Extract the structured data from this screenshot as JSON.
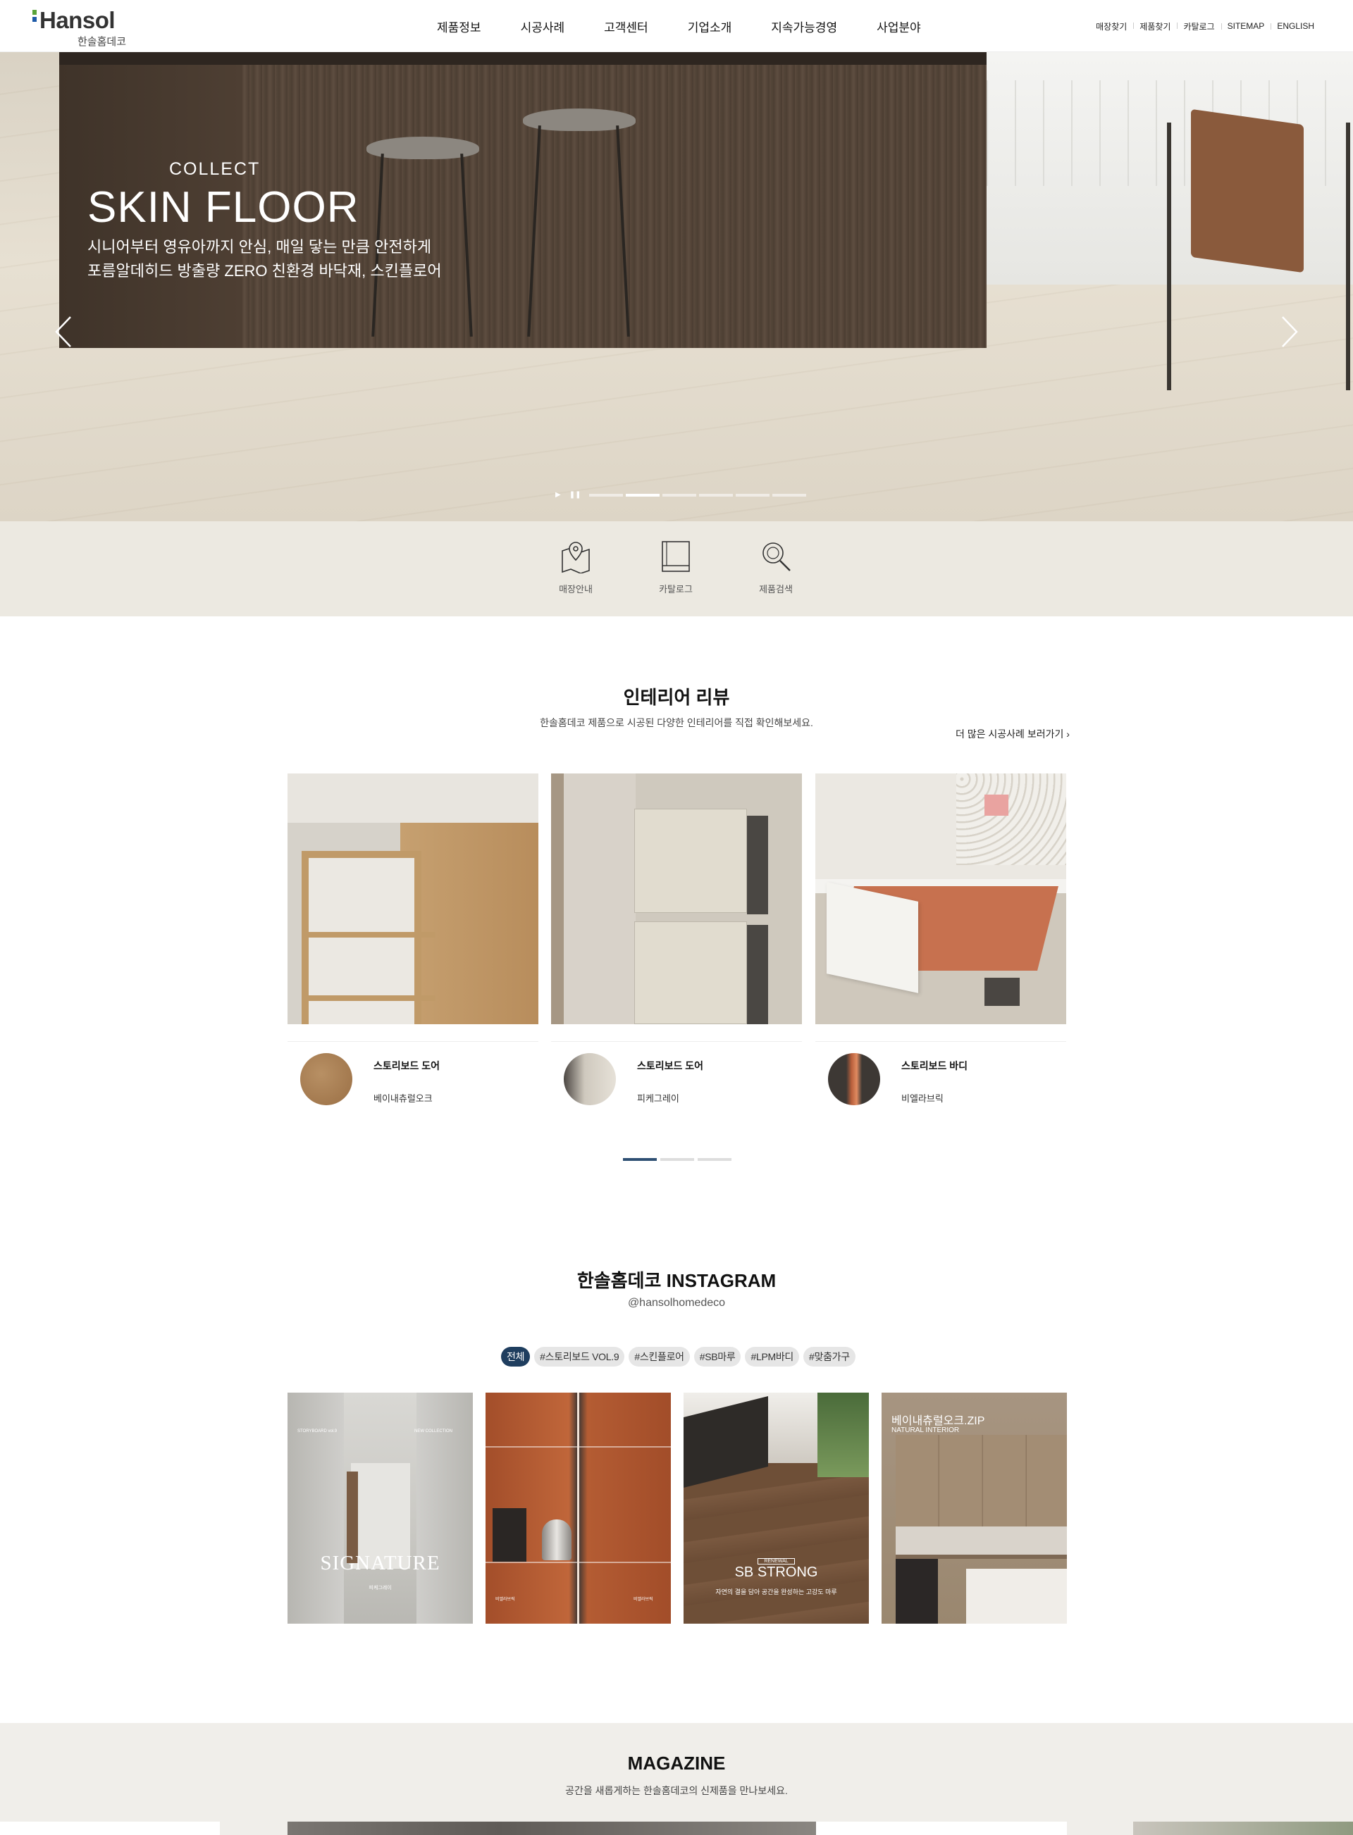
{
  "header": {
    "logo_word": "Hansol",
    "logo_sub": "한솔홈데코",
    "nav": [
      "제품정보",
      "시공사례",
      "고객센터",
      "기업소개",
      "지속가능경영",
      "사업분야"
    ],
    "util": [
      "매장찾기",
      "제품찾기",
      "카탈로그",
      "SITEMAP",
      "ENGLISH"
    ]
  },
  "hero": {
    "kicker": "COLLECT",
    "title": "SKIN FLOOR",
    "desc_line1": "시니어부터 영유아까지 안심, 매일 닿는 만큼 안전하게",
    "desc_line2": "포름알데히드 방출량 ZERO 친환경 바닥재, 스킨플로어",
    "slide_count": 6,
    "active_slide": 2,
    "play_icon": "play-icon",
    "pause_icon": "pause-icon"
  },
  "quick_links": [
    {
      "label": "매장안내",
      "icon": "map-pin-icon"
    },
    {
      "label": "카탈로그",
      "icon": "book-icon"
    },
    {
      "label": "제품검색",
      "icon": "search-icon"
    }
  ],
  "review": {
    "title": "인테리어 리뷰",
    "subtitle": "한솔홈데코 제품으로 시공된 다양한 인테리어를 직접 확인해보세요.",
    "more": "더 많은 시공사례 보러가기",
    "cards": [
      {
        "name": "스토리보드 도어",
        "color": "베이내츄럴오크"
      },
      {
        "name": "스토리보드 도어",
        "color": "피케그레이"
      },
      {
        "name": "스토리보드 바디",
        "color": "비엘라브릭"
      }
    ],
    "page_count": 3,
    "active_page": 1
  },
  "instagram": {
    "title": "한솔홈데코 INSTAGRAM",
    "handle": "@hansolhomedeco",
    "tags": [
      "전체",
      "#스토리보드 VOL.9",
      "#스킨플로어",
      "#SB마루",
      "#LPM바디",
      "#맞춤가구"
    ],
    "active_tag": 0,
    "posts": [
      {
        "overlay": "SIGNATURE",
        "small": "피케그레이",
        "top_left": "STORYBOARD vol.9",
        "top_right": "NEW COLLECTION"
      },
      {
        "overlay": "",
        "small_left": "비엘라브릭",
        "small_right": "비엘라브릭"
      },
      {
        "overlay": "SB STRONG",
        "badge": "RENEWAL",
        "small": "자연의 결을 담아 공간을 완성하는 고강도 마루"
      },
      {
        "overlay": "베이내츄럴오크.ZIP",
        "small": "NATURAL INTERIOR"
      }
    ]
  },
  "magazine": {
    "title": "MAGAZINE",
    "subtitle": "공간을 새롭게하는 한솔홈데코의 신제품을 만나보세요."
  },
  "colors": {
    "accent": "#1f3e5f",
    "pager_active": "#2e4f73",
    "logo_green": "#5aa33a",
    "logo_blue": "#1e5aa8"
  }
}
